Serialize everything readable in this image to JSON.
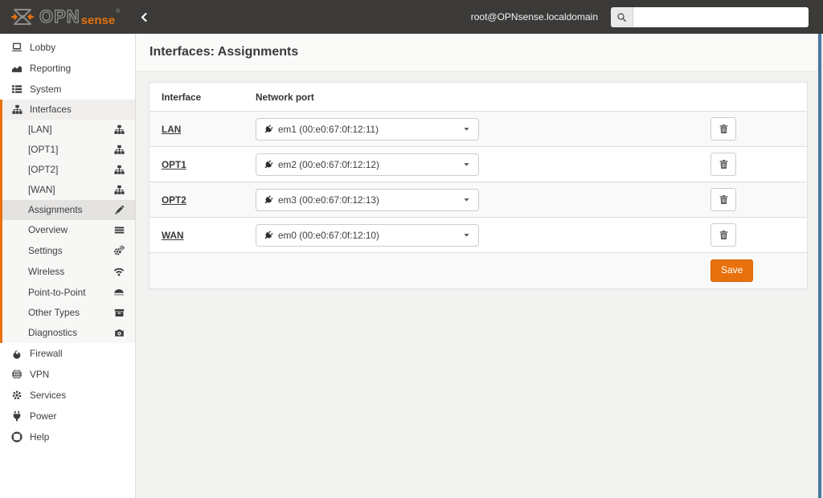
{
  "header": {
    "brand": {
      "opn": "OPN",
      "sense": "sense",
      "reg": "®"
    },
    "user": "root@OPNsense.localdomain",
    "search": {
      "value": "",
      "placeholder": ""
    }
  },
  "sidebar": {
    "top_items": [
      {
        "label": "Lobby",
        "icon": "laptop"
      },
      {
        "label": "Reporting",
        "icon": "area-chart"
      },
      {
        "label": "System",
        "icon": "th-list"
      }
    ],
    "interfaces_group": {
      "parent": {
        "label": "Interfaces",
        "icon": "sitemap"
      },
      "children": [
        {
          "label": "[LAN]",
          "icon": "sitemap"
        },
        {
          "label": "[OPT1]",
          "icon": "sitemap"
        },
        {
          "label": "[OPT2]",
          "icon": "sitemap"
        },
        {
          "label": "[WAN]",
          "icon": "sitemap"
        },
        {
          "label": "Assignments",
          "icon": "pencil",
          "active": true
        },
        {
          "label": "Overview",
          "icon": "reorder"
        },
        {
          "label": "Settings",
          "icon": "cogs"
        },
        {
          "label": "Wireless",
          "icon": "wifi"
        },
        {
          "label": "Point-to-Point",
          "icon": "modem"
        },
        {
          "label": "Other Types",
          "icon": "archive"
        },
        {
          "label": "Diagnostics",
          "icon": "camera"
        }
      ]
    },
    "bottom_items": [
      {
        "label": "Firewall",
        "icon": "fire"
      },
      {
        "label": "VPN",
        "icon": "globe"
      },
      {
        "label": "Services",
        "icon": "cog"
      },
      {
        "label": "Power",
        "icon": "plug"
      },
      {
        "label": "Help",
        "icon": "life-ring"
      }
    ]
  },
  "main": {
    "title": "Interfaces: Assignments",
    "table": {
      "headers": {
        "interface": "Interface",
        "network_port": "Network port"
      },
      "rows": [
        {
          "interface": "LAN",
          "port": "em1 (00:e0:67:0f:12:11)"
        },
        {
          "interface": "OPT1",
          "port": "em2 (00:e0:67:0f:12:12)"
        },
        {
          "interface": "OPT2",
          "port": "em3 (00:e0:67:0f:12:13)"
        },
        {
          "interface": "WAN",
          "port": "em0 (00:e0:67:0f:12:10)"
        }
      ],
      "save_label": "Save"
    }
  },
  "colors": {
    "accent": "#e8710d",
    "header_bg": "#3b3a38",
    "scrollbar_thumb": "#4b79a1"
  }
}
